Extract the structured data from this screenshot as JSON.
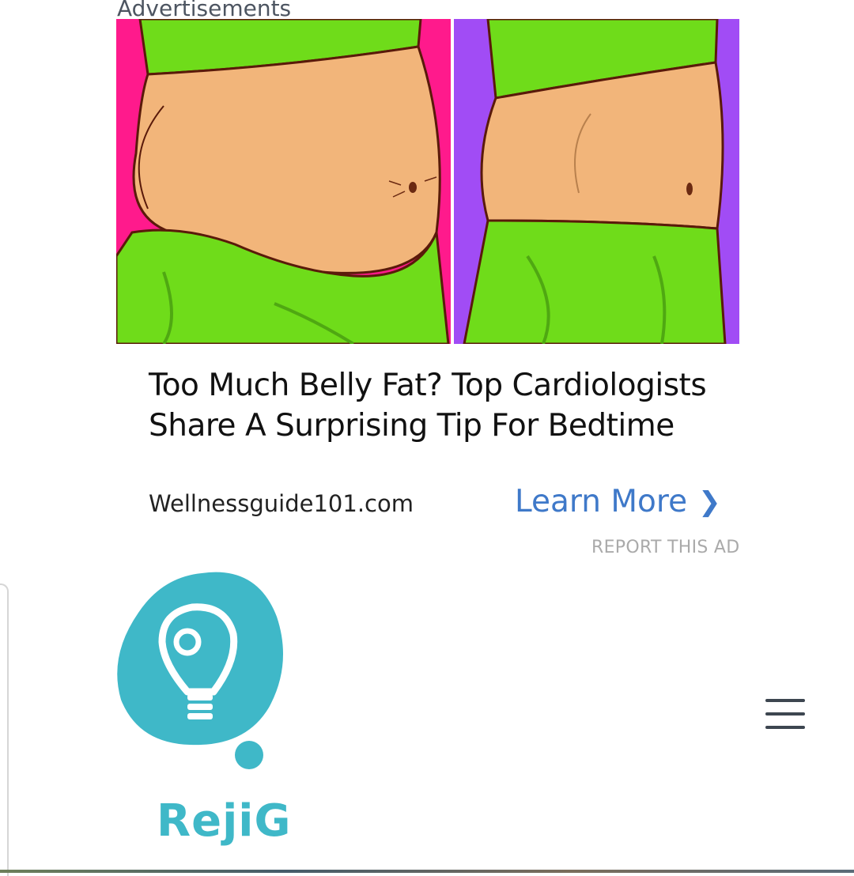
{
  "ad": {
    "label": "Advertisements",
    "title": "Too Much Belly Fat? Top Cardiologists Share A Surprising Tip For Bedtime",
    "source": "Wellnessguide101.com",
    "cta_label": "Learn More",
    "cta_icon": "chevron-right-icon",
    "report_label": "REPORT THIS AD",
    "image_colors": {
      "left_bg": "#ff1a8c",
      "right_bg": "#a14cf5",
      "clothing": "#6fdc1a",
      "skin": "#f2b57a"
    }
  },
  "site": {
    "logo_icon": "lightbulb-icon",
    "logo_text": "RejiG",
    "brand_color": "#3fb8c8",
    "menu_icon": "hamburger-menu-icon"
  }
}
